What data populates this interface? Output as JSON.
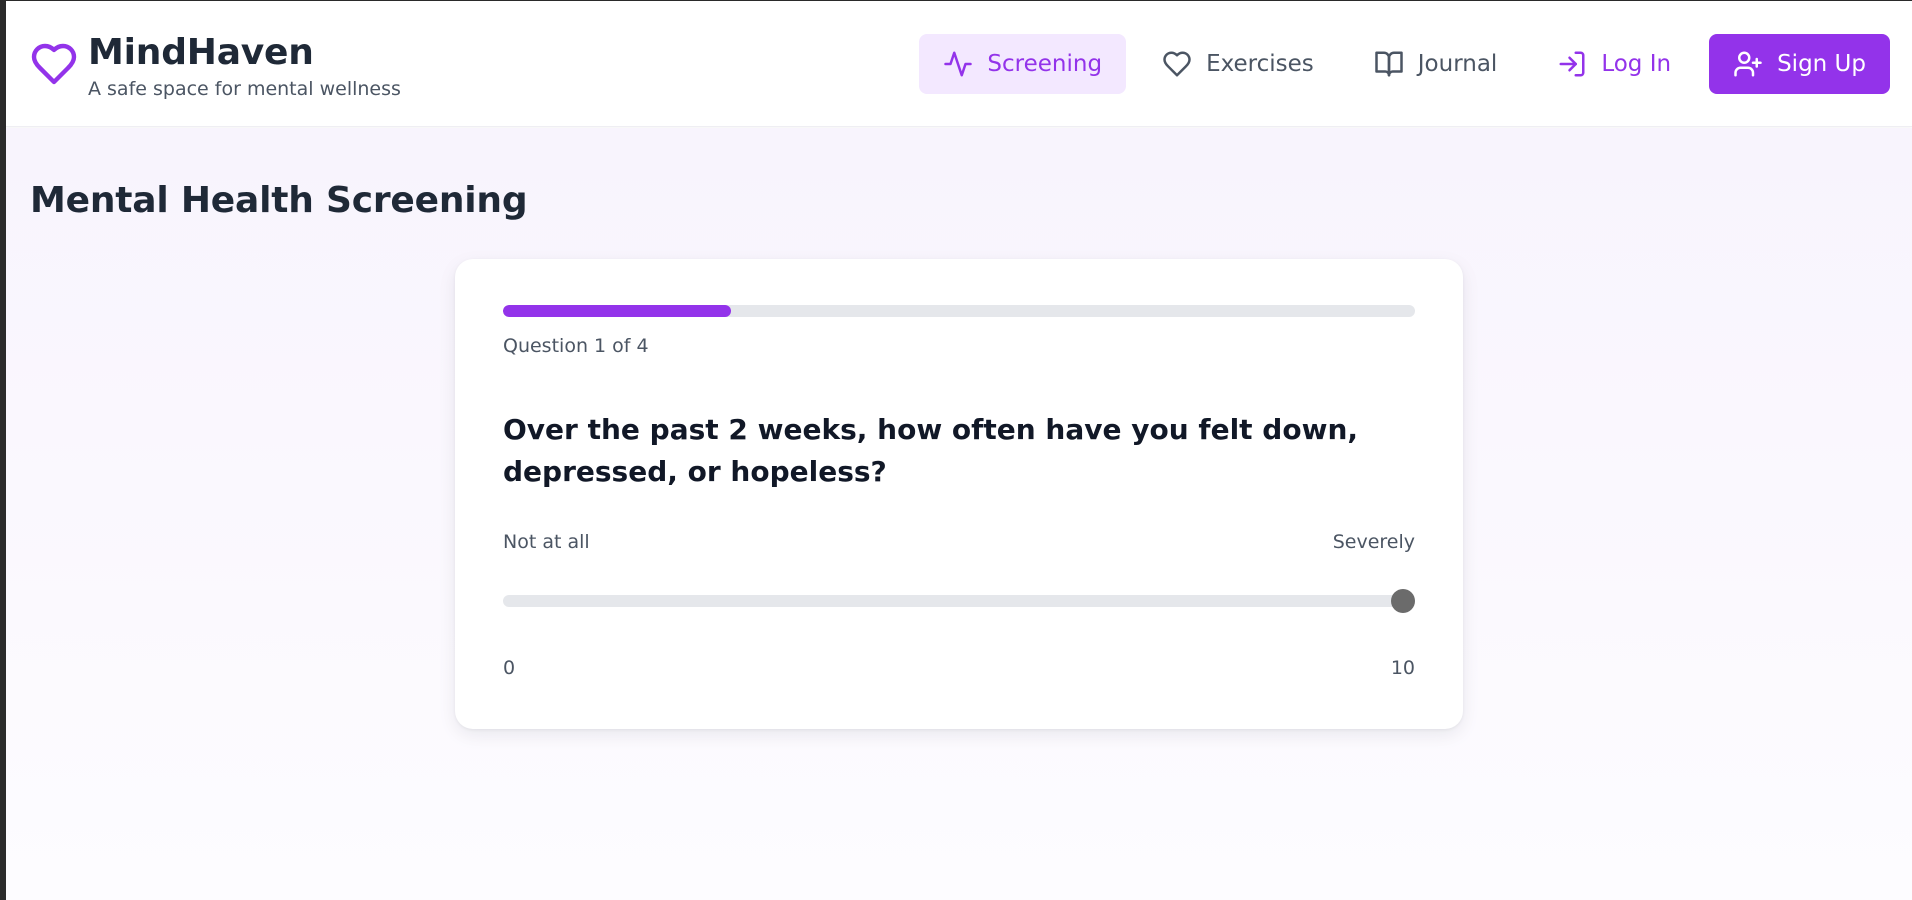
{
  "brand": {
    "icon": "heart-icon",
    "title": "MindHaven",
    "subtitle": "A safe space for mental wellness",
    "accent_color": "#9333ea"
  },
  "nav": {
    "items": [
      {
        "label": "Screening",
        "icon": "activity-icon",
        "active": true
      },
      {
        "label": "Exercises",
        "icon": "heart-icon",
        "active": false
      },
      {
        "label": "Journal",
        "icon": "book-open-icon",
        "active": false
      }
    ],
    "login": {
      "label": "Log In",
      "icon": "log-in-icon"
    },
    "signup": {
      "label": "Sign Up",
      "icon": "user-plus-icon"
    }
  },
  "page": {
    "title": "Mental Health Screening"
  },
  "screening": {
    "progress_text": "Question 1 of 4",
    "progress_fraction": 0.25,
    "question": "Over the past 2 weeks, how often have you felt down, depressed, or hopeless?",
    "scale": {
      "left_label": "Not at all",
      "right_label": "Severely",
      "min": "0",
      "max": "10",
      "value": 10
    }
  }
}
